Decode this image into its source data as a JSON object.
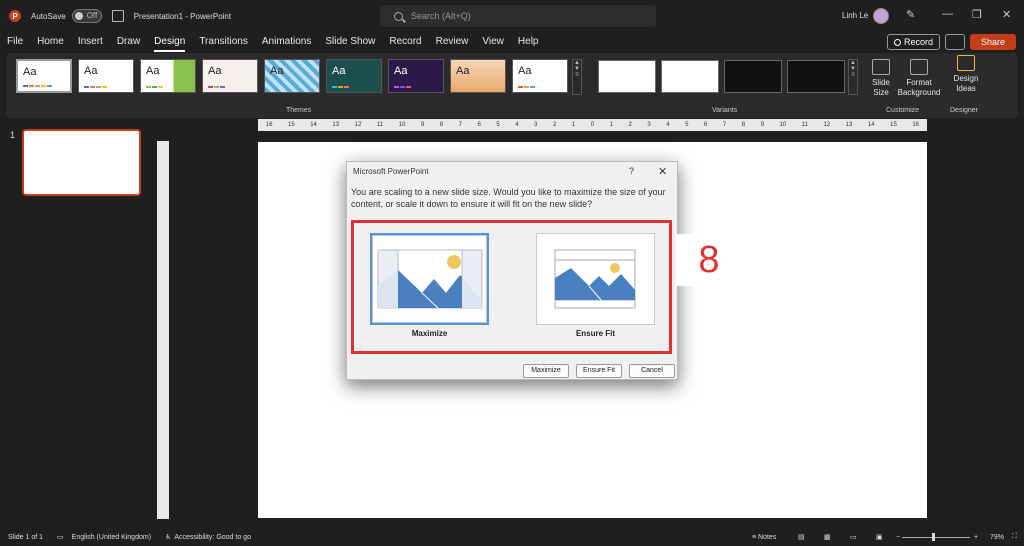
{
  "titlebar": {
    "autosave_label": "AutoSave",
    "autosave_state": "Off",
    "document_title": "Presentation1 - PowerPoint",
    "search_placeholder": "Search (Alt+Q)",
    "user_name": "Linh Le"
  },
  "menu": {
    "items": [
      "File",
      "Home",
      "Insert",
      "Draw",
      "Design",
      "Transitions",
      "Animations",
      "Slide Show",
      "Record",
      "Review",
      "View",
      "Help"
    ],
    "active": "Design",
    "record_label": "Record",
    "share_label": "Share"
  },
  "ribbon": {
    "themes_label": "Themes",
    "variants_label": "Variants",
    "customize_label": "Customize",
    "designer_label": "Designer",
    "theme_sample_text": "Aa",
    "slide_size_label": "Slide Size",
    "format_background_label": "Format Background",
    "design_ideas_label": "Design Ideas"
  },
  "slides_pane": {
    "slide_number": "1"
  },
  "ruler": {
    "ticks": [
      "16",
      "15",
      "14",
      "13",
      "12",
      "11",
      "10",
      "9",
      "8",
      "7",
      "6",
      "5",
      "4",
      "3",
      "2",
      "1",
      "0",
      "1",
      "2",
      "3",
      "4",
      "5",
      "6",
      "7",
      "8",
      "9",
      "10",
      "11",
      "12",
      "13",
      "14",
      "15",
      "16"
    ]
  },
  "dialog": {
    "title": "Microsoft PowerPoint",
    "help": "?",
    "close": "✕",
    "message": "You are scaling to a new slide size.  Would you like to maximize the size of your content, or scale it down to ensure it will fit on the new slide?",
    "option_maximize_label": "Maximize",
    "option_ensure_fit_label": "Ensure Fit",
    "button_maximize": "Maximize",
    "button_ensure_fit": "Ensure Fit",
    "button_cancel": "Cancel"
  },
  "annotation": {
    "step_number": "8",
    "color": "#e03131"
  },
  "statusbar": {
    "slide_info": "Slide 1 of 1",
    "language": "English (United Kingdom)",
    "accessibility": "Accessibility: Good to go",
    "notes_label": "Notes",
    "zoom": "79%"
  },
  "colors": {
    "accent": "#c43e1c",
    "selection": "#5b8fd6"
  }
}
